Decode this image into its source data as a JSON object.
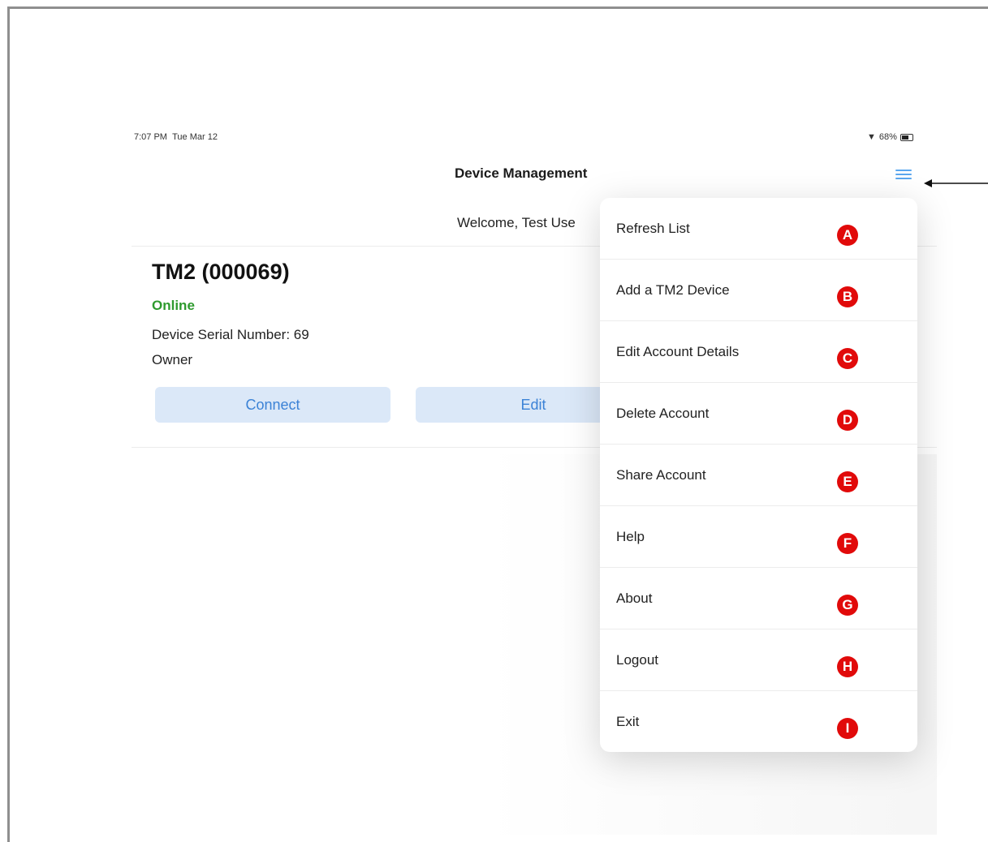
{
  "status_bar": {
    "time": "7:07 PM",
    "date": "Tue Mar 12",
    "battery": "68%",
    "wifi_icon": "wifi-icon",
    "battery_icon": "battery-icon"
  },
  "nav": {
    "title": "Device Management",
    "menu_icon": "hamburger-menu-icon",
    "accent": "#5aa7ef"
  },
  "welcome": "Welcome, Test Use",
  "device": {
    "name": "TM2 (000069)",
    "status": "Online",
    "status_color": "#2e9a2e",
    "serial": "Device Serial Number: 69",
    "role": "Owner",
    "connect_label": "Connect",
    "edit_label": "Edit"
  },
  "menu": {
    "items": [
      {
        "label": "Refresh List",
        "marker": "A"
      },
      {
        "label": "Add a TM2 Device",
        "marker": "B"
      },
      {
        "label": "Edit Account Details",
        "marker": "C"
      },
      {
        "label": "Delete Account",
        "marker": "D"
      },
      {
        "label": "Share Account",
        "marker": "E"
      },
      {
        "label": "Help",
        "marker": "F"
      },
      {
        "label": "About",
        "marker": "G"
      },
      {
        "label": "Logout",
        "marker": "H"
      },
      {
        "label": "Exit",
        "marker": "I"
      }
    ],
    "marker_color": "#e10a0a"
  }
}
